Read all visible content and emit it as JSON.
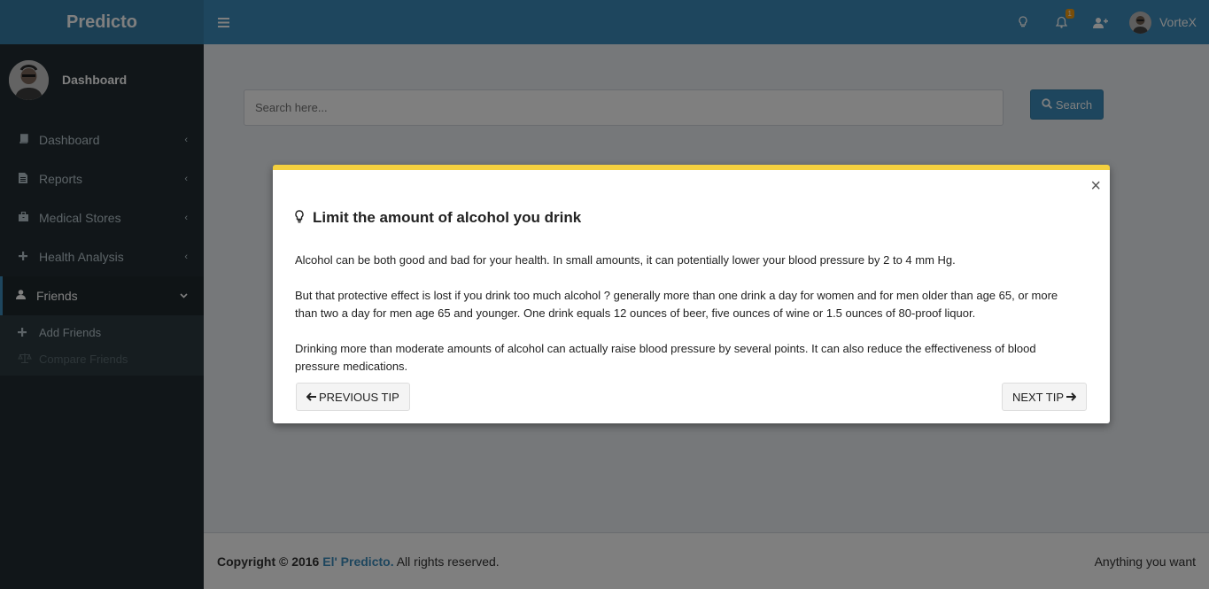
{
  "header": {
    "logo": "Predicto",
    "user_name": "VorteX",
    "notification_count": "1"
  },
  "sidebar": {
    "panel_name": "Dashboard",
    "items": [
      {
        "label": "Dashboard",
        "icon": "book-icon"
      },
      {
        "label": "Reports",
        "icon": "file-icon"
      },
      {
        "label": "Medical Stores",
        "icon": "briefcase-icon"
      },
      {
        "label": "Health Analysis",
        "icon": "plus-icon"
      },
      {
        "label": "Friends",
        "icon": "user-icon"
      }
    ],
    "submenu": [
      {
        "label": "Add Friends",
        "icon": "plus-icon"
      },
      {
        "label": "Compare Friends",
        "icon": "balance-scale-icon"
      }
    ]
  },
  "main": {
    "search_placeholder": "Search here...",
    "search_label": "Search"
  },
  "modal": {
    "title": "Limit the amount of alcohol you drink",
    "paragraphs": [
      "Alcohol can be both good and bad for your health. In small amounts, it can potentially lower your blood pressure by 2 to 4 mm Hg.",
      "But that protective effect is lost if you drink too much alcohol ? generally more than one drink a day for women and for men older than age 65, or more than two a day for men age 65 and younger. One drink equals 12 ounces of beer, five ounces of wine or 1.5 ounces of 80-proof liquor.",
      "Drinking more than moderate amounts of alcohol can actually raise blood pressure by several points. It can also reduce the effectiveness of blood pressure medications."
    ],
    "prev_label": "PREVIOUS TIP",
    "next_label": "NEXT TIP",
    "close_symbol": "×"
  },
  "footer": {
    "copyright": "Copyright © 2016",
    "brand": "El' Predicto.",
    "rights": "All rights reserved.",
    "right_text": "Anything you want"
  },
  "colors": {
    "navbar": "#3c8dbc",
    "logo_bg": "#367fa9",
    "sidebar": "#222d32",
    "modal_accent": "#f4d03f"
  }
}
